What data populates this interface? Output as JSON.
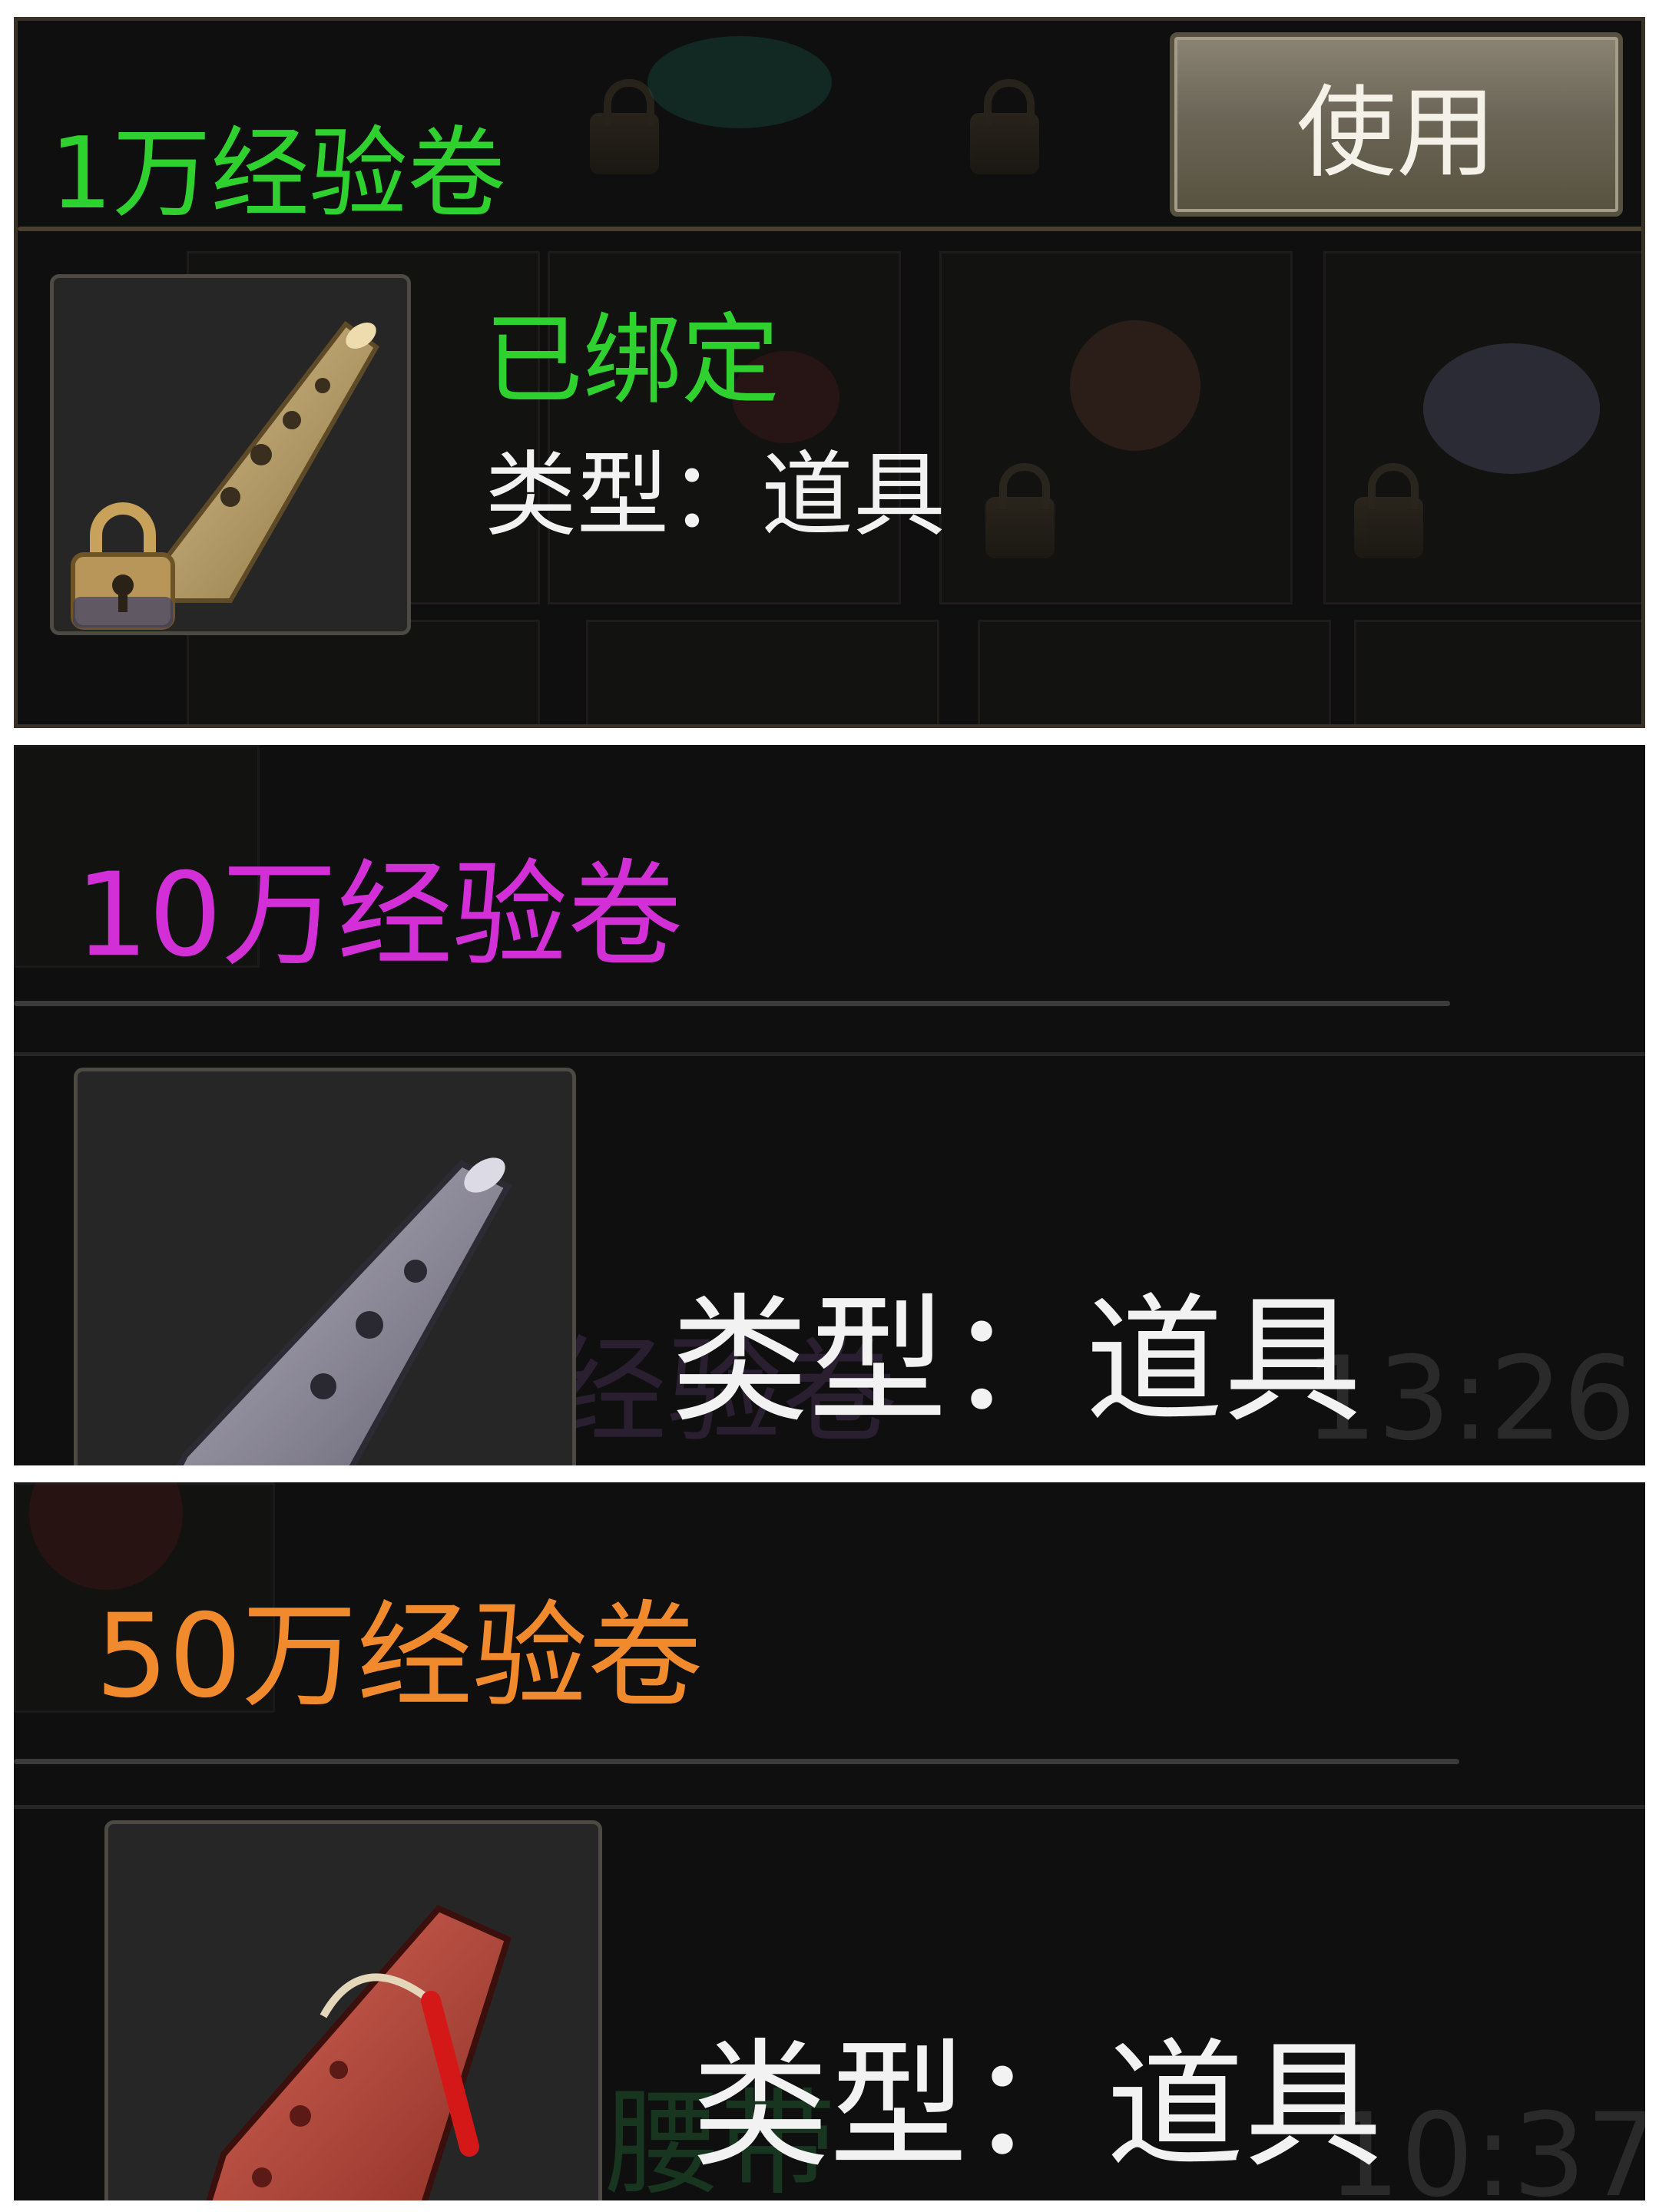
{
  "panels": [
    {
      "title": "1万经验卷",
      "title_color": "#2ed12e",
      "action_button": "使用",
      "status": "已绑定",
      "status_color": "#2ed12e",
      "type_label": "类型",
      "type_colon": "：",
      "type_value": "道具",
      "icon": "scroll-tan-icon",
      "locked": true
    },
    {
      "title": "10万经验卷",
      "title_color": "#d230d6",
      "type_label": "类型",
      "type_colon": "：",
      "type_value": "道具",
      "icon": "scroll-grey-icon",
      "locked": false,
      "background_time": "13:26"
    },
    {
      "title": "50万经验卷",
      "title_color": "#f08a2c",
      "type_label": "类型",
      "type_colon": "：",
      "type_value": "道具",
      "icon": "scroll-red-icon",
      "locked": false,
      "background_time": "10:37"
    }
  ]
}
